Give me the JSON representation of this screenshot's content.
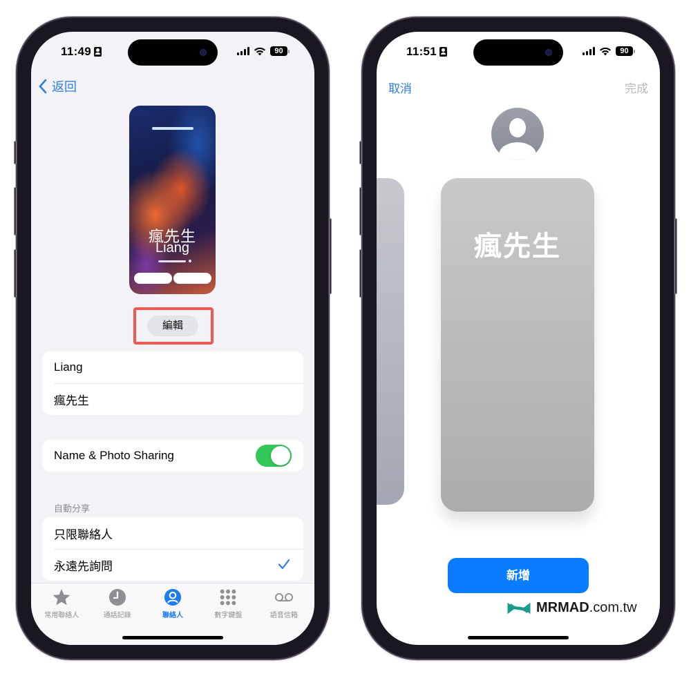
{
  "left_phone": {
    "status_bar": {
      "time": "11:49",
      "battery": "90"
    },
    "nav": {
      "back_label": "返回"
    },
    "poster": {
      "name_cn": "瘋先生",
      "name_en": "Liang"
    },
    "edit_button": "編輯",
    "name_rows": [
      "Liang",
      "瘋先生"
    ],
    "sharing": {
      "label": "Name & Photo Sharing",
      "enabled": true,
      "accent": "#34c759"
    },
    "auto_share": {
      "section_label": "自動分享",
      "options": [
        {
          "label": "只限聯絡人",
          "selected": false
        },
        {
          "label": "永遠先詢問",
          "selected": true
        }
      ]
    },
    "tab_bar": {
      "items": [
        {
          "label": "常用聯絡人",
          "icon": "star-icon",
          "active": false
        },
        {
          "label": "通話記錄",
          "icon": "clock-icon",
          "active": false
        },
        {
          "label": "聯絡人",
          "icon": "person-circle-icon",
          "active": true
        },
        {
          "label": "數字鍵盤",
          "icon": "keypad-icon",
          "active": false
        },
        {
          "label": "語音信箱",
          "icon": "voicemail-icon",
          "active": false
        }
      ]
    },
    "highlight_color": "#f0594c"
  },
  "right_phone": {
    "status_bar": {
      "time": "11:51",
      "battery": "90"
    },
    "nav": {
      "cancel_label": "取消",
      "done_label": "完成"
    },
    "card": {
      "name_cn": "瘋先生"
    },
    "add_button": "新增",
    "accent": "#0a7cff"
  },
  "watermark": {
    "brand": "MRMAD",
    "domain": ".com.tw"
  }
}
